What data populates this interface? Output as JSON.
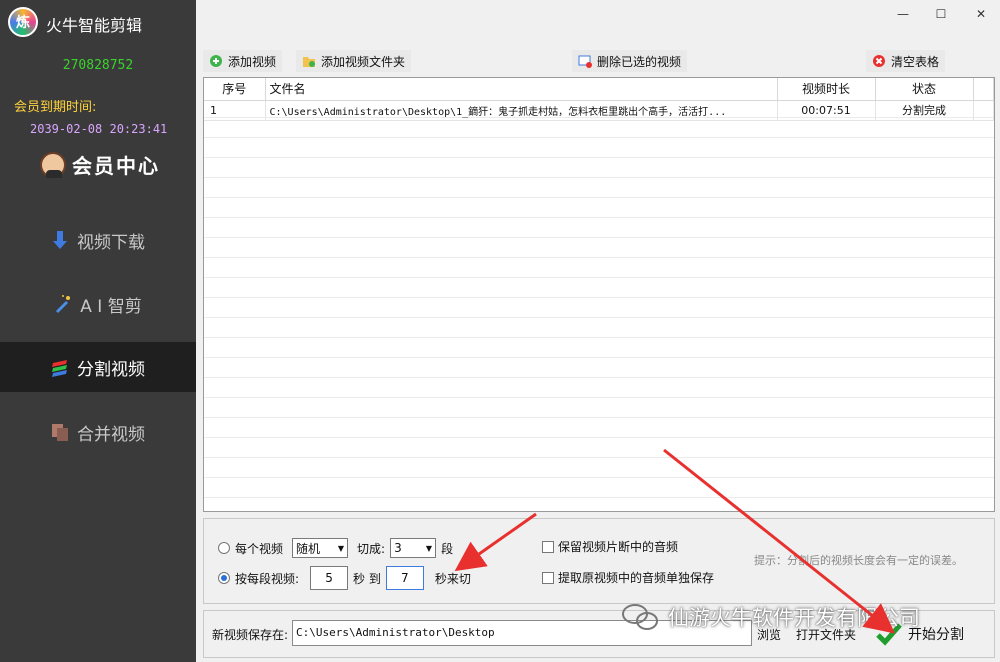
{
  "app": {
    "title": "火牛智能剪辑",
    "logo_text": "炼"
  },
  "sidebar": {
    "user_id": "270828752",
    "expire_label": "会员到期时间:",
    "expire_time": "2039-02-08 20:23:41",
    "member_center": "会员中心",
    "items": [
      {
        "label": "视频下载",
        "icon": "download-arrow-icon",
        "active": false
      },
      {
        "label": "A I 智剪",
        "icon": "ai-wand-icon",
        "active": false
      },
      {
        "label": "分割视频",
        "icon": "split-layers-icon",
        "active": true
      },
      {
        "label": "合并视频",
        "icon": "merge-pages-icon",
        "active": false
      }
    ]
  },
  "window": {
    "minimize": "—",
    "maximize": "☐",
    "close": "✕"
  },
  "toolbar": {
    "add_video": "添加视频",
    "add_folder": "添加视频文件夹",
    "delete_selected": "删除已选的视频",
    "clear_table": "清空表格"
  },
  "table": {
    "headers": [
      "序号",
      "文件名",
      "视频时长",
      "状态"
    ],
    "rows": [
      {
        "index": "1",
        "filename": "C:\\Users\\Administrator\\Desktop\\1_鏑犴：鬼子抓走村姑，怎料衣柜里跳出个高手，活活打...",
        "duration": "00:07:51",
        "status": "分割完成"
      }
    ]
  },
  "options": {
    "per_video_label": "每个视频",
    "mode_select": "随机",
    "cut_into_label": "切成:",
    "segments_select": "3",
    "segments_unit": "段",
    "per_segment_label": "按每段视频:",
    "from_seconds": "5",
    "seconds_to": "秒 到",
    "to_seconds": "7",
    "seconds_cut": "秒来切",
    "keep_audio": "保留视频片断中的音频",
    "extract_audio": "提取原视频中的音频单独保存",
    "hint": "提示：分割后的视频长度会有一定的误差。"
  },
  "bottom": {
    "save_label": "新视频保存在:",
    "save_path": "C:\\Users\\Administrator\\Desktop",
    "browse": "浏览",
    "open_folder": "打开文件夹",
    "start_split": "开始分割"
  },
  "watermark": "仙游火牛软件开发有限公司",
  "colors": {
    "sidebar_bg": "#3a3a3a",
    "active_bg": "#1f1f1f",
    "user_id": "#39d42b",
    "expire_label": "#ffd23a",
    "expire_time": "#d9a6ff",
    "annotation_arrow": "#e8312f"
  }
}
